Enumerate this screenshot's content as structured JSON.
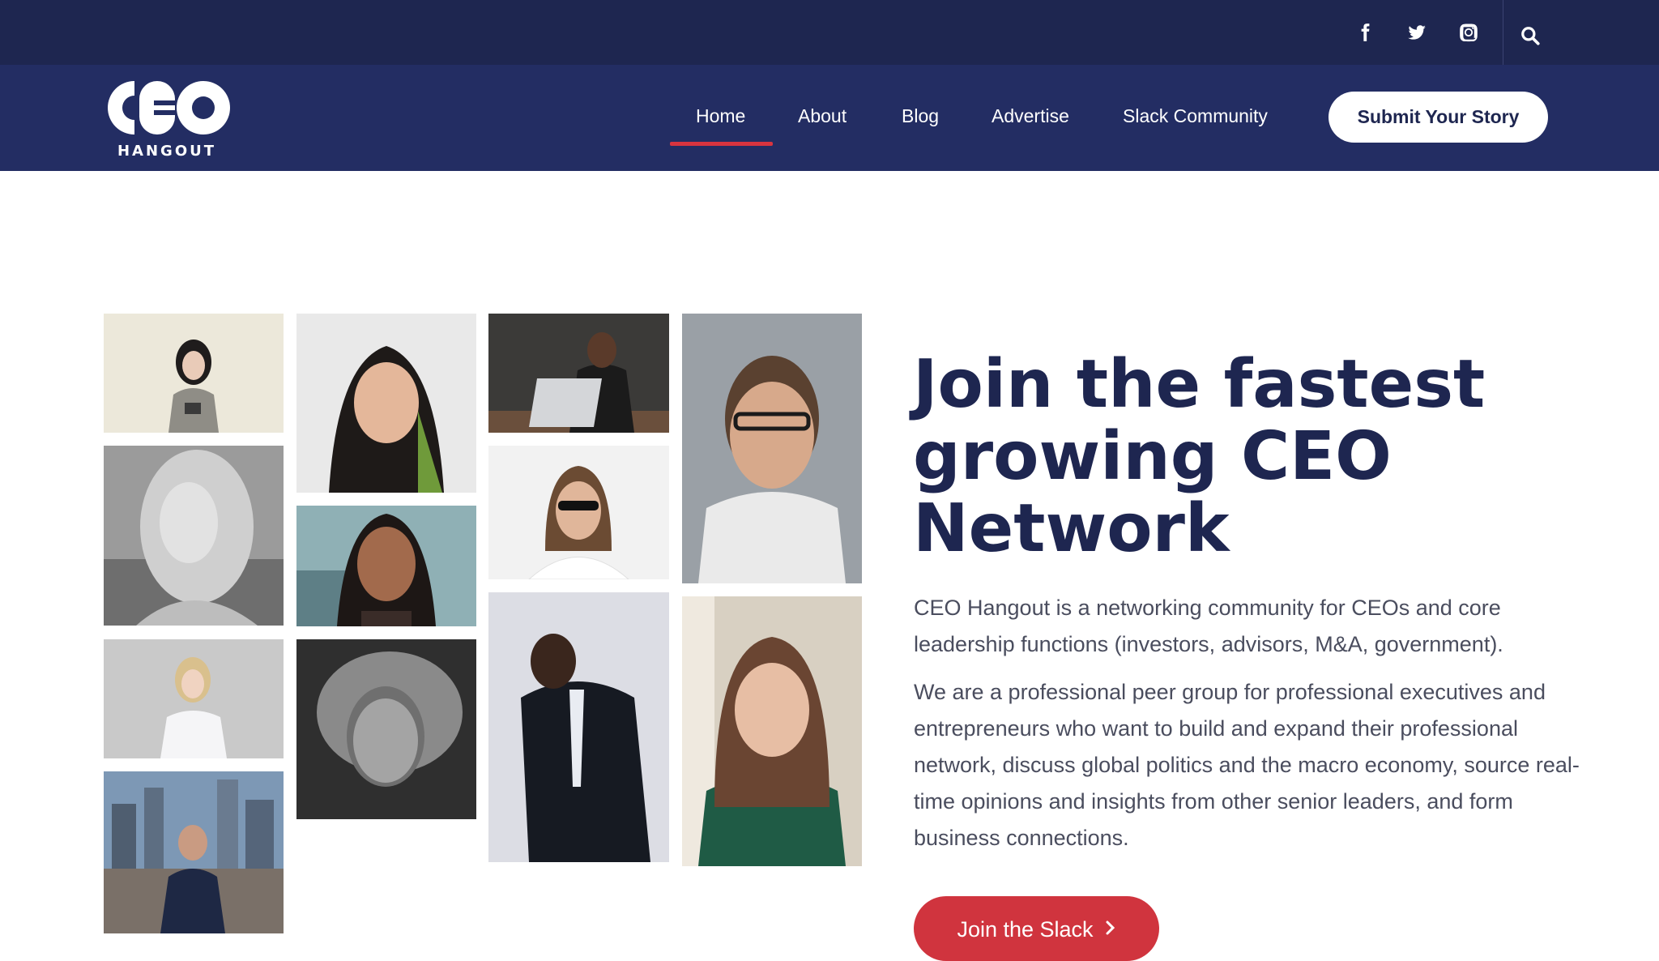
{
  "header": {
    "social": [
      {
        "name": "facebook-icon"
      },
      {
        "name": "twitter-icon"
      },
      {
        "name": "instagram-icon"
      }
    ],
    "search_icon": "search-icon"
  },
  "brand": {
    "logo_main": "CEO",
    "logo_sub": "HANGOUT"
  },
  "nav": {
    "items": [
      {
        "label": "Home",
        "active": true
      },
      {
        "label": "About"
      },
      {
        "label": "Blog"
      },
      {
        "label": "Advertise"
      },
      {
        "label": "Slack Community"
      }
    ],
    "submit_label": "Submit Your Story"
  },
  "hero": {
    "headline": "Join the fastest growing CEO Network",
    "paragraph1": "CEO Hangout is a networking community for CEOs and core leadership functions (investors, advisors, M&A, government).",
    "paragraph2": "We are a professional peer group for professional executives and entrepreneurs who want to build and expand their professional network, discuss global politics and the macro economy, source real-time opinions and insights from other senior leaders, and form business connections.",
    "cta_label": "Join the Slack"
  },
  "colors": {
    "topbar": "#1e2650",
    "navbar": "#232d63",
    "accent": "#d8343f",
    "headline": "#1e2650",
    "body_text": "#4a4d5e"
  }
}
